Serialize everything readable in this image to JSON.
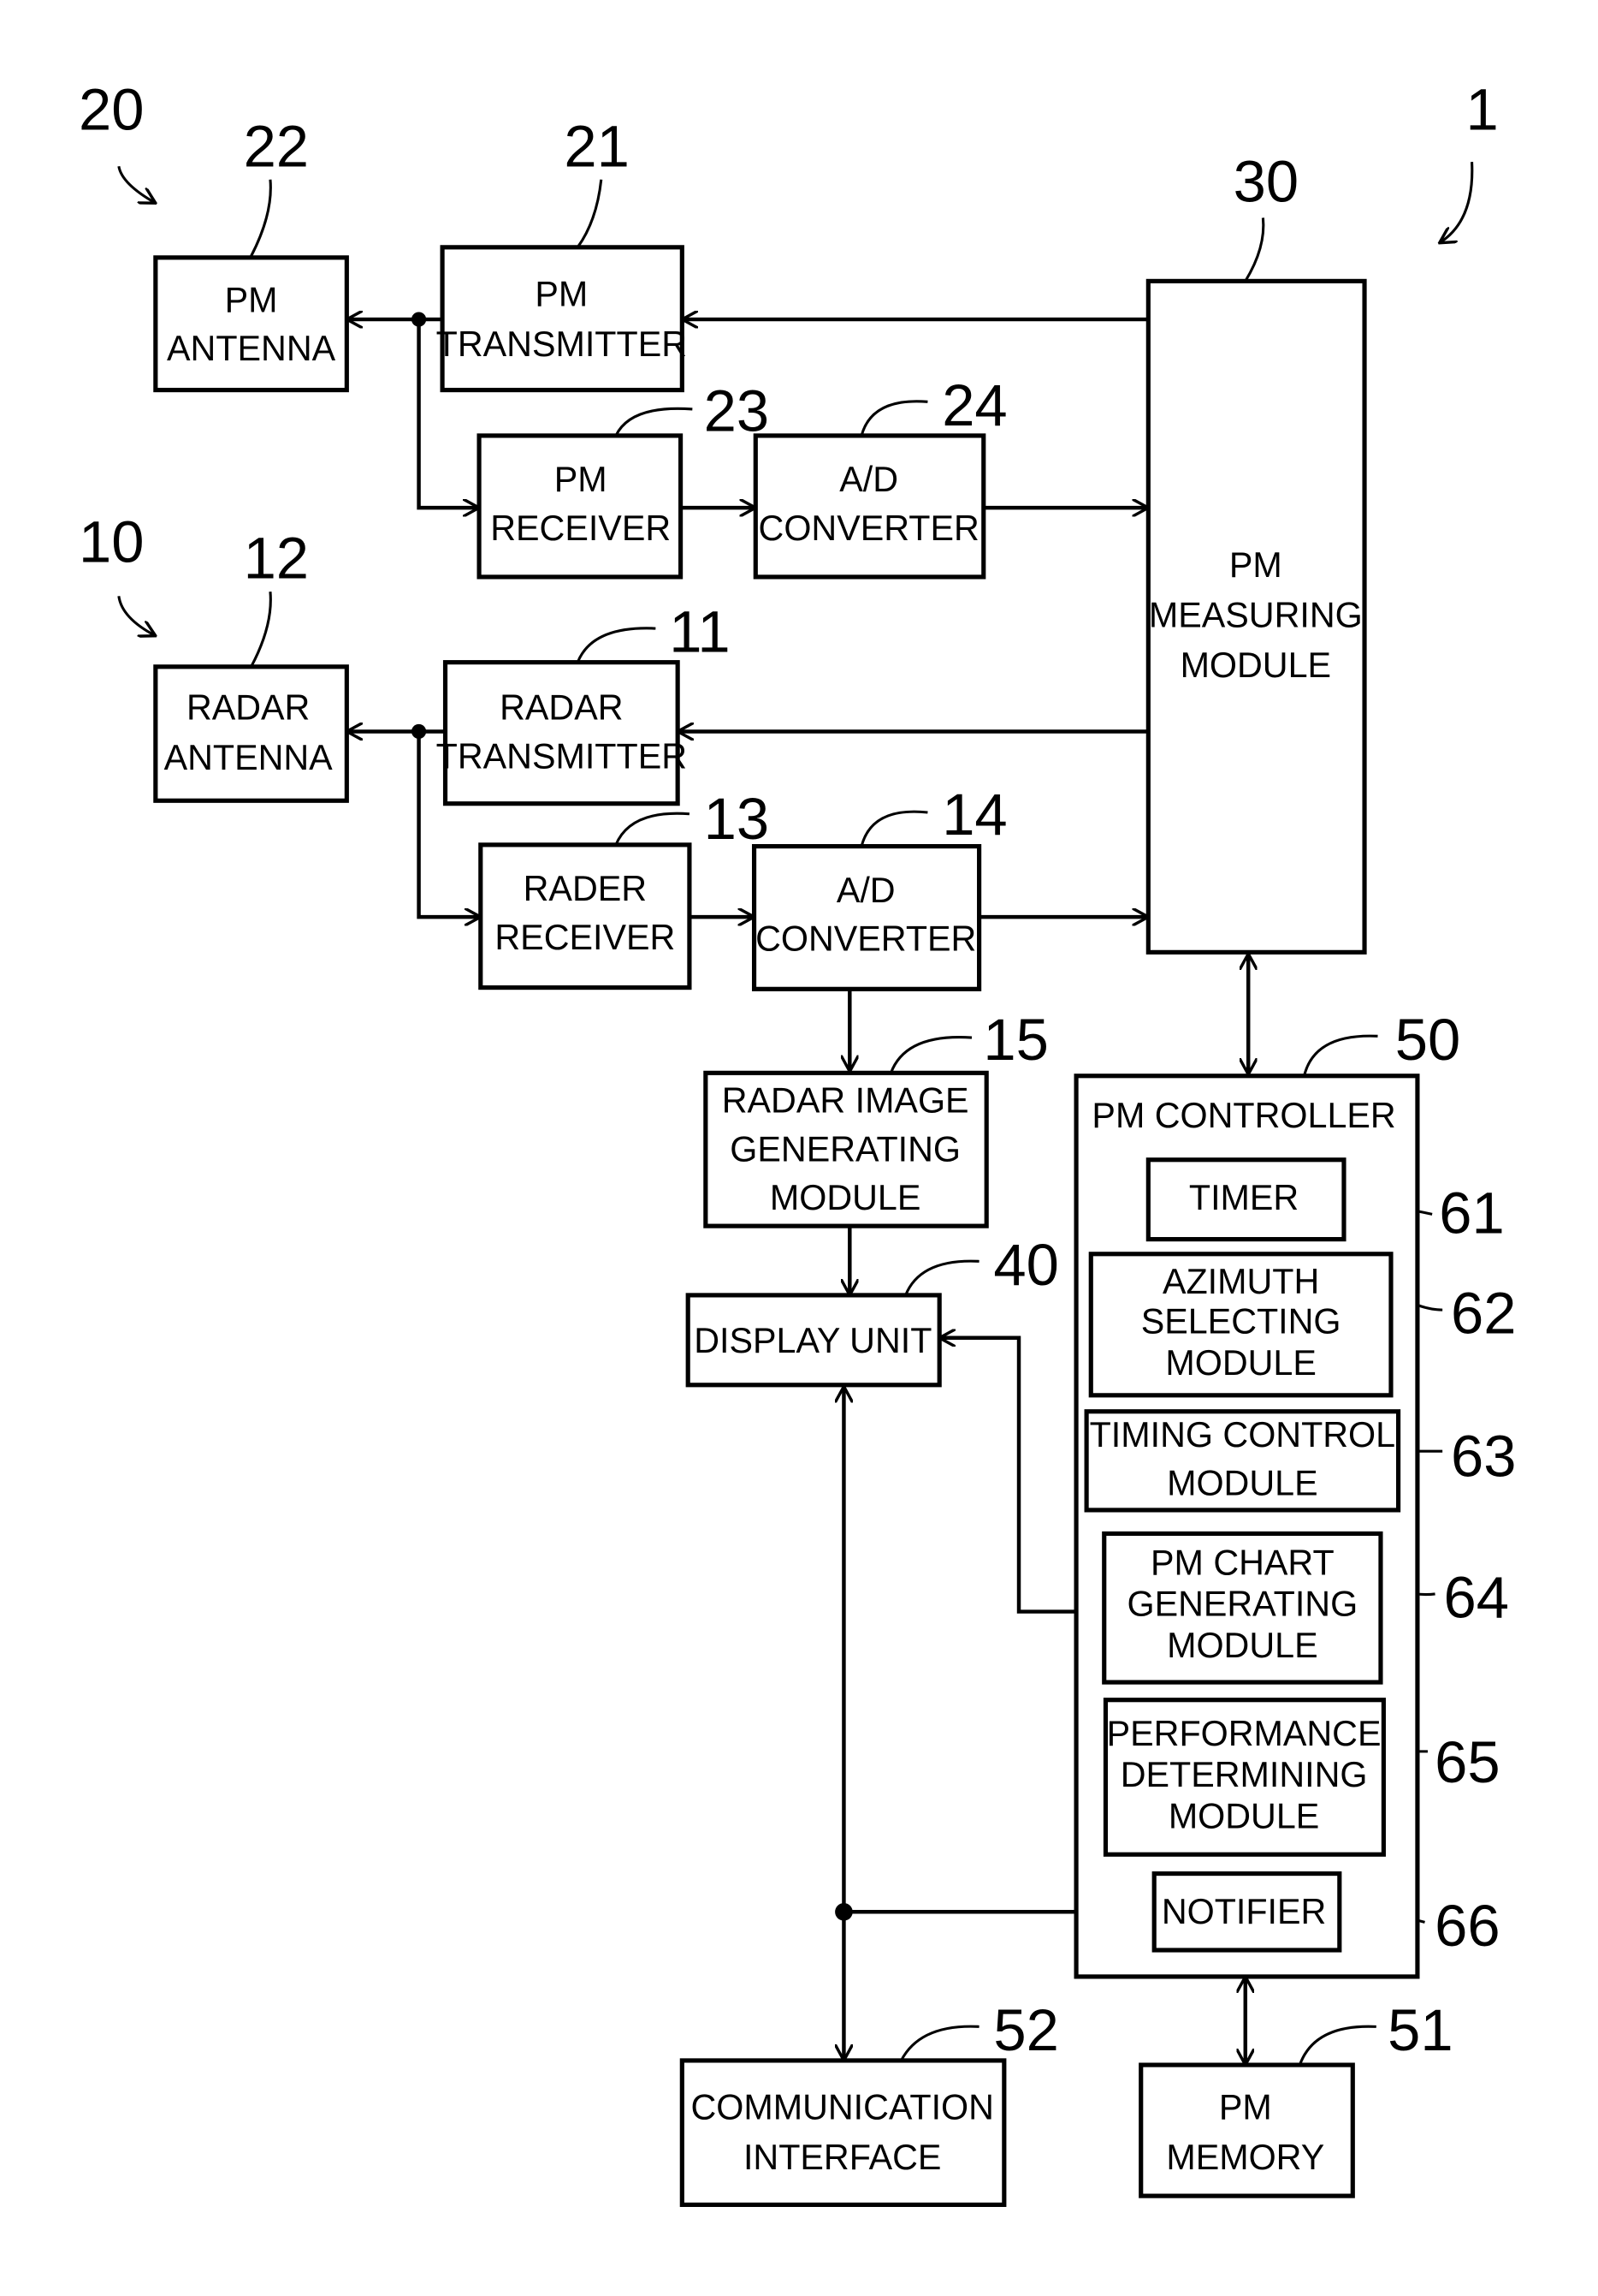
{
  "figure": {
    "ref": "1"
  },
  "groups": {
    "g20": "20",
    "g10": "10"
  },
  "blocks": {
    "pm_antenna": {
      "ref": "22",
      "lines": [
        "PM",
        "ANTENNA"
      ]
    },
    "pm_transmitter": {
      "ref": "21",
      "lines": [
        "PM",
        "TRANSMITTER"
      ]
    },
    "pm_receiver": {
      "ref": "23",
      "lines": [
        "PM",
        "RECEIVER"
      ]
    },
    "ad_converter_pm": {
      "ref": "24",
      "lines": [
        "A/D",
        "CONVERTER"
      ]
    },
    "radar_antenna": {
      "ref": "12",
      "lines": [
        "RADAR",
        "ANTENNA"
      ]
    },
    "radar_transmitter": {
      "ref": "11",
      "lines": [
        "RADAR",
        "TRANSMITTER"
      ]
    },
    "radar_receiver": {
      "ref": "13",
      "lines": [
        "RADER",
        "RECEIVER"
      ]
    },
    "ad_converter_radar": {
      "ref": "14",
      "lines": [
        "A/D",
        "CONVERTER"
      ]
    },
    "pm_measuring": {
      "ref": "30",
      "lines": [
        "PM",
        "MEASURING",
        "MODULE"
      ]
    },
    "radar_image": {
      "ref": "15",
      "lines": [
        "RADAR IMAGE",
        "GENERATING",
        "MODULE"
      ]
    },
    "display_unit": {
      "ref": "40",
      "lines": [
        "DISPLAY UNIT"
      ]
    },
    "pm_controller": {
      "ref": "50",
      "lines": [
        "PM CONTROLLER"
      ]
    },
    "timer": {
      "ref": "61",
      "lines": [
        "TIMER"
      ]
    },
    "azimuth": {
      "ref": "62",
      "lines": [
        "AZIMUTH",
        "SELECTING",
        "MODULE"
      ]
    },
    "timing": {
      "ref": "63",
      "lines": [
        "TIMING CONTROL",
        "MODULE"
      ]
    },
    "pm_chart": {
      "ref": "64",
      "lines": [
        "PM CHART",
        "GENERATING",
        "MODULE"
      ]
    },
    "performance": {
      "ref": "65",
      "lines": [
        "PERFORMANCE",
        "DETERMINING",
        "MODULE"
      ]
    },
    "notifier": {
      "ref": "66",
      "lines": [
        "NOTIFIER"
      ]
    },
    "communication": {
      "ref": "52",
      "lines": [
        "COMMUNICATION",
        "INTERFACE"
      ]
    },
    "pm_memory": {
      "ref": "51",
      "lines": [
        "PM",
        "MEMORY"
      ]
    }
  }
}
